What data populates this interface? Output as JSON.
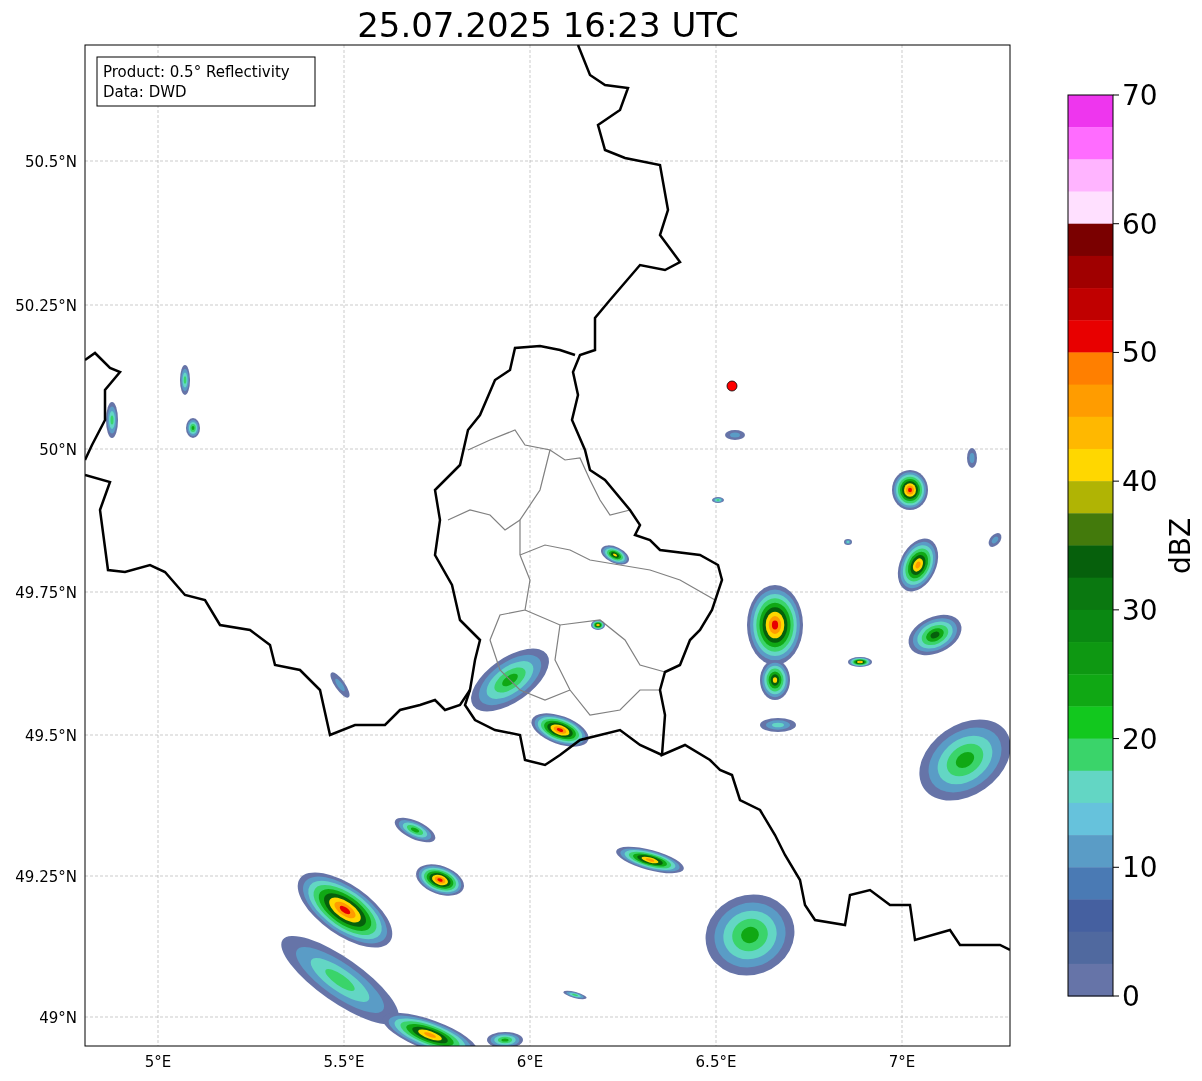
{
  "title": "25.07.2025 16:23 UTC",
  "info_box": [
    "Product: 0.5° Reflectivity",
    "Data: DWD"
  ],
  "x_ticks": [
    "5°E",
    "5.5°E",
    "6°E",
    "6.5°E",
    "7°E"
  ],
  "y_ticks": [
    "50.5°N",
    "50.25°N",
    "50°N",
    "49.75°N",
    "49.5°N",
    "49.25°N",
    "49°N"
  ],
  "colorbar": {
    "label": "dBZ",
    "ticks": [
      "70",
      "60",
      "50",
      "40",
      "30",
      "20",
      "10",
      "0"
    ],
    "bins": [
      {
        "color": "#ee36ee"
      },
      {
        "color": "#ff6cff"
      },
      {
        "color": "#ffb4ff"
      },
      {
        "color": "#ffe0ff"
      },
      {
        "color": "#7a0000"
      },
      {
        "color": "#a00000"
      },
      {
        "color": "#c00000"
      },
      {
        "color": "#e80000"
      },
      {
        "color": "#ff7f00"
      },
      {
        "color": "#ff9c00"
      },
      {
        "color": "#ffb800"
      },
      {
        "color": "#ffd700"
      },
      {
        "color": "#b0b404"
      },
      {
        "color": "#437a0c"
      },
      {
        "color": "#06600c"
      },
      {
        "color": "#0a7810"
      },
      {
        "color": "#0a8812"
      },
      {
        "color": "#0e9812"
      },
      {
        "color": "#10a814"
      },
      {
        "color": "#12c81e"
      },
      {
        "color": "#3ad46a"
      },
      {
        "color": "#63d6c4"
      },
      {
        "color": "#66c2dc"
      },
      {
        "color": "#5a9cc6"
      },
      {
        "color": "#4a7ab4"
      },
      {
        "color": "#4560a0"
      },
      {
        "color": "#50699f"
      },
      {
        "color": "#6674a8"
      }
    ]
  }
}
